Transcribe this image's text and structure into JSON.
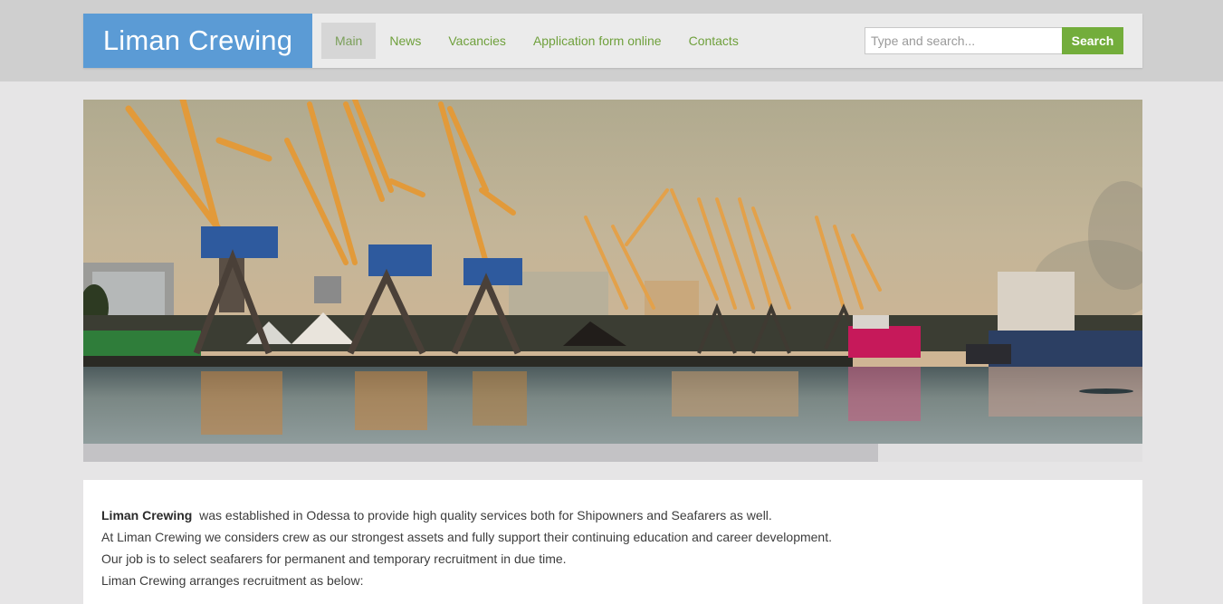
{
  "brand": {
    "name": "Liman Crewing"
  },
  "nav": {
    "items": [
      {
        "label": "Main",
        "active": true
      },
      {
        "label": "News"
      },
      {
        "label": "Vacancies"
      },
      {
        "label": "Application form online"
      },
      {
        "label": "Contacts"
      }
    ]
  },
  "search": {
    "placeholder": "Type and search...",
    "value": "",
    "button_label": "Search"
  },
  "slider": {
    "progress_fraction": 0.75
  },
  "intro": {
    "lead_bold": "Liman Crewing",
    "lead_rest": "  was established in Odessa to provide high quality services both for Shipowners and Seafarers as well.",
    "lines": [
      "At Liman Crewing we considers crew as our strongest assets and fully support their continuing education and career development.",
      "Our job is to select seafarers for permanent and temporary recruitment in due time.",
      "Liman Crewing arranges recruitment as below:"
    ]
  },
  "colors": {
    "brand_blue": "#5b9bd5",
    "link_green": "#6fa03c",
    "search_green": "#73ad3b"
  },
  "icons": [
    "harbor-photo"
  ]
}
